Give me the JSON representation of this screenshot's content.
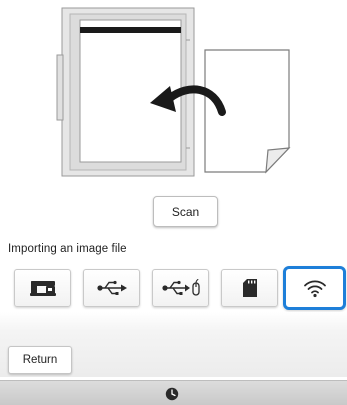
{
  "main": {
    "scan_label": "Scan",
    "import_section_label": "Importing an image file"
  },
  "import_sources": [
    {
      "name": "machine",
      "icon": "embroidery-machine-icon"
    },
    {
      "name": "usb",
      "icon": "usb-icon"
    },
    {
      "name": "usb-mouse",
      "icon": "usb-mouse-icon"
    },
    {
      "name": "sd-card",
      "icon": "sd-card-icon"
    },
    {
      "name": "wireless",
      "icon": "wifi-icon",
      "selected": true
    }
  ],
  "footer": {
    "return_label": "Return"
  },
  "colors": {
    "accent": "#1e7fd9",
    "scanner_frame": "#e6e6e6",
    "status_bar": "#cfcfcf"
  }
}
